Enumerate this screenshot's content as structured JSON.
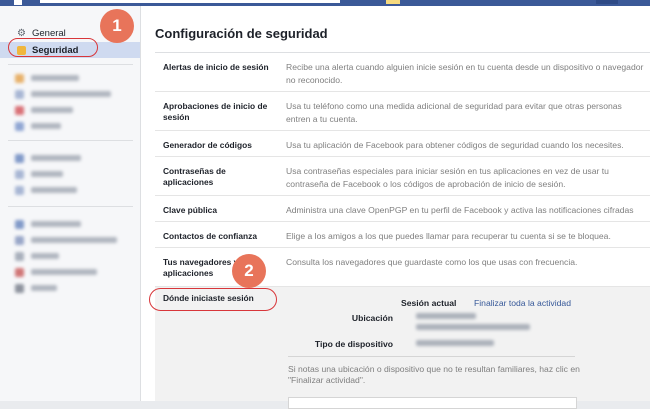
{
  "colors": {
    "accent": "#3b5998",
    "link": "#365899",
    "callout": "#e8745a",
    "callout_ring": "#d8363a"
  },
  "sidebar": {
    "general_label": "General",
    "security_label": "Seguridad",
    "general_icon": "gear-icon",
    "security_icon": "shield-icon"
  },
  "page": {
    "title": "Configuración de seguridad"
  },
  "settings": [
    {
      "label": "Alertas de inicio de sesión",
      "description": "Recibe una alerta cuando alguien inicie sesión en tu cuenta desde un dispositivo o navegador\nno reconocido."
    },
    {
      "label": "Aprobaciones de inicio de sesión",
      "description": "Usa tu teléfono como una medida adicional de seguridad para evitar que otras personas\nentren a tu cuenta."
    },
    {
      "label": "Generador de códigos",
      "description": "Usa tu aplicación de Facebook para obtener códigos de seguridad cuando los necesites."
    },
    {
      "label": "Contraseñas de aplicaciones",
      "description": "Usa contraseñas especiales para iniciar sesión en tus aplicaciones en vez de usar tu\ncontraseña de Facebook o los códigos de aprobación de inicio de sesión."
    },
    {
      "label": "Clave pública",
      "description": "Administra una clave OpenPGP en tu perfil de Facebook y activa las notificaciones cifradas"
    },
    {
      "label": "Contactos de confianza",
      "description": "Elige a los amigos a los que puedes llamar para recuperar tu cuenta si se te bloquea."
    },
    {
      "label": "Tus navegadores y aplicaciones",
      "description": "Consulta los navegadores que guardaste como los que usas con frecuencia."
    }
  ],
  "locations": {
    "label": "Dónde iniciaste sesión",
    "current_session": "Sesión actual",
    "end_all": "Finalizar toda la actividad",
    "location_label": "Ubicación",
    "device_label": "Tipo de dispositivo",
    "note": "Si notas una ubicación o dispositivo que no te resultan familiares, haz clic en \"Finalizar actividad\"."
  },
  "callouts": {
    "one": "1",
    "two": "2"
  }
}
